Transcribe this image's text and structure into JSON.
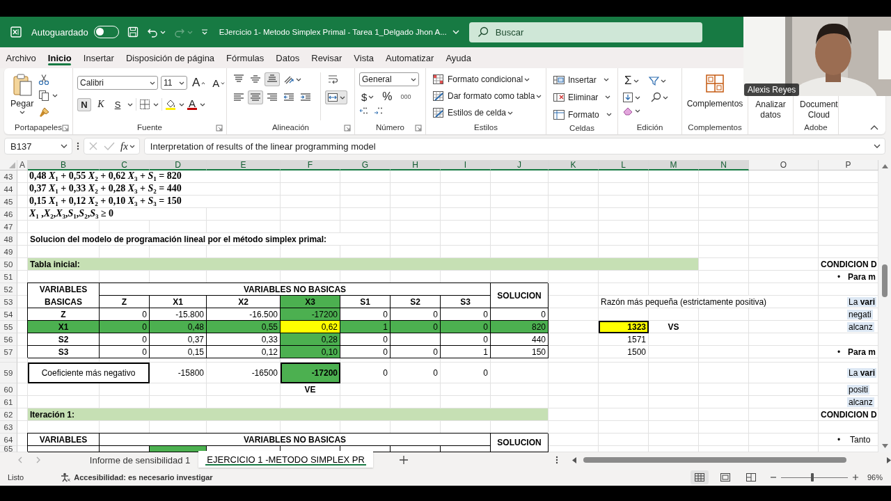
{
  "titlebar": {
    "autosave_label": "Autoguardado",
    "autosave": {
      "on": false
    },
    "title": "EJercicio 1- Metodo Simplex Primal - Tarea 1_Delgado Jhon A...",
    "search": {
      "placeholder": "Buscar"
    }
  },
  "menu": {
    "tabs": [
      {
        "label": "Archivo",
        "selected": false
      },
      {
        "label": "Inicio",
        "selected": true
      },
      {
        "label": "Insertar",
        "selected": false
      },
      {
        "label": "Disposición de página",
        "selected": false
      },
      {
        "label": "Fórmulas",
        "selected": false
      },
      {
        "label": "Datos",
        "selected": false
      },
      {
        "label": "Revisar",
        "selected": false
      },
      {
        "label": "Vista",
        "selected": false
      },
      {
        "label": "Automatizar",
        "selected": false
      },
      {
        "label": "Ayuda",
        "selected": false
      }
    ]
  },
  "ribbon": {
    "groups": [
      {
        "kind": "clipboard",
        "label": "Portapapeles",
        "paste": "Pegar"
      },
      {
        "kind": "font",
        "label": "Fuente",
        "font": "Calibri",
        "size": "11",
        "grow": "A",
        "shrink": "A",
        "styles": [
          {
            "kind": "bold",
            "label": "N",
            "pressed": true
          },
          {
            "kind": "italic",
            "label": "K",
            "pressed": false
          },
          {
            "kind": "underline",
            "label": "S",
            "pressed": false
          }
        ],
        "font_color": "A"
      },
      {
        "kind": "alignment",
        "label": "Alineación",
        "top_row": [
          {
            "kind": "top",
            "pressed": false
          },
          {
            "kind": "middle",
            "pressed": false
          },
          {
            "kind": "bottom",
            "pressed": true
          },
          {
            "kind": "orientation",
            "pressed": false
          },
          {
            "kind": "wrap",
            "pressed": false
          }
        ],
        "bottom_row": [
          {
            "kind": "left",
            "pressed": false
          },
          {
            "kind": "center",
            "pressed": true
          },
          {
            "kind": "right",
            "pressed": false
          },
          {
            "kind": "outdent",
            "pressed": false
          },
          {
            "kind": "indent",
            "pressed": false
          },
          {
            "kind": "merge",
            "pressed": true
          }
        ]
      },
      {
        "kind": "number",
        "label": "Número",
        "format": "General",
        "currency": "$",
        "percent": "%",
        "thousands": "000"
      },
      {
        "kind": "styles",
        "label": "Estilos",
        "items": [
          "Formato condicional",
          "Dar formato como tabla",
          "Estilos de celda"
        ]
      },
      {
        "kind": "cells",
        "label": "Celdas",
        "items": [
          "Insertar",
          "Eliminar",
          "Formato"
        ]
      },
      {
        "kind": "editing",
        "label": "Edición",
        "autosum": "Σ"
      },
      {
        "kind": "big",
        "label": "Complementos",
        "button": "Complementos"
      },
      {
        "kind": "covered",
        "button": "Analizar datos"
      },
      {
        "kind": "covered",
        "label": "Adobe",
        "button": "Document Cloud"
      }
    ]
  },
  "formula_bar": {
    "name_box": "B137",
    "fx": "fx",
    "content": "Interpretation of results of the linear programming model"
  },
  "sheet": {
    "columns": [
      {
        "label": "A",
        "selected": false
      },
      {
        "label": "B",
        "selected": true
      },
      {
        "label": "C",
        "selected": true
      },
      {
        "label": "D",
        "selected": true
      },
      {
        "label": "E",
        "selected": true
      },
      {
        "label": "F",
        "selected": true
      },
      {
        "label": "G",
        "selected": true
      },
      {
        "label": "H",
        "selected": true
      },
      {
        "label": "I",
        "selected": true
      },
      {
        "label": "J",
        "selected": true
      },
      {
        "label": "K",
        "selected": true
      },
      {
        "label": "L",
        "selected": true
      },
      {
        "label": "M",
        "selected": true
      },
      {
        "label": "N",
        "selected": true
      },
      {
        "label": "O",
        "selected": false
      },
      {
        "label": "P",
        "selected": false
      }
    ],
    "rows": [
      {
        "number": "43",
        "cells": [
          {
            "kind": "empty"
          },
          {
            "kind": "equation",
            "text": "0,48 *X*$_{1}$ + 0,55 *X*$_{2}$ + 0,62 *X*$_{3}$ + *S*$_{1}$ = 820"
          },
          {
            "kind": "merge"
          },
          {
            "kind": "merge"
          },
          {
            "kind": "merge"
          }
        ]
      },
      {
        "number": "44",
        "cells": [
          {
            "kind": "empty"
          },
          {
            "kind": "equation",
            "text": "0,37 *X*$_{1}$ + 0,33 *X*$_{2}$ + 0,28 *X*$_{3}$ + *S*$_{2}$ = 440"
          },
          {
            "kind": "merge"
          },
          {
            "kind": "merge"
          },
          {
            "kind": "merge"
          }
        ]
      },
      {
        "number": "45",
        "cells": [
          {
            "kind": "empty"
          },
          {
            "kind": "equation",
            "text": "0,15 *X*$_{1}$ + 0,12 *X*$_{2}$ + 0,10 *X*$_{3}$ + *S*$_{3}$ = 150"
          },
          {
            "kind": "merge"
          },
          {
            "kind": "merge"
          },
          {
            "kind": "merge"
          }
        ]
      },
      {
        "number": "46",
        "cells": [
          {
            "kind": "empty"
          },
          {
            "kind": "equation",
            "text": "*X*$_{1}$ ,*X*$_{2}$,*X*$_{3}$,*S*$_{1}$,*S*$_{2}$,*S*$_{3}$ ≥ 0"
          },
          {
            "kind": "merge"
          },
          {
            "kind": "merge"
          }
        ]
      },
      {
        "number": "47"
      },
      {
        "number": "48",
        "cells": [
          {
            "kind": "empty"
          },
          {
            "kind": "text",
            "bold": true,
            "text": "Solucion del modelo de programación lineal por el método simplex primal:"
          },
          {
            "kind": "merge"
          },
          {
            "kind": "merge"
          },
          {
            "kind": "merge"
          },
          {
            "kind": "merge"
          },
          {
            "kind": "merge"
          }
        ]
      },
      {
        "number": "49"
      },
      {
        "number": "50",
        "cells": [
          {
            "kind": "empty"
          },
          {
            "kind": "text",
            "bold": true,
            "color": "#c6e0b4",
            "text": "Tabla inicial:"
          },
          {
            "kind": "merge"
          },
          {
            "kind": "merge"
          },
          {
            "kind": "merge"
          },
          {
            "kind": "merge"
          },
          {
            "kind": "merge"
          },
          {
            "kind": "merge"
          },
          {
            "kind": "merge"
          },
          {
            "kind": "merge"
          },
          {
            "kind": "merge"
          },
          {
            "kind": "merge"
          },
          {
            "kind": "merge"
          },
          {
            "kind": "empty"
          },
          {
            "kind": "empty"
          },
          {
            "kind": "text",
            "bold": true,
            "text": "CONDICION D"
          }
        ]
      },
      {
        "number": "51",
        "cells": [
          {
            "kind": "empty"
          },
          {
            "kind": "empty"
          },
          {
            "kind": "empty"
          },
          {
            "kind": "empty"
          },
          {
            "kind": "empty"
          },
          {
            "kind": "empty"
          },
          {
            "kind": "empty"
          },
          {
            "kind": "empty"
          },
          {
            "kind": "empty"
          },
          {
            "kind": "empty"
          },
          {
            "kind": "empty"
          },
          {
            "kind": "empty"
          },
          {
            "kind": "empty"
          },
          {
            "kind": "empty"
          },
          {
            "kind": "empty"
          },
          {
            "kind": "bullet",
            "marker": "•",
            "bold": true,
            "text": "Para m"
          }
        ]
      },
      {
        "number": "52",
        "cells": [
          {
            "kind": "empty"
          },
          {
            "kind": "center",
            "bold": true,
            "bordered": true,
            "text": "VARIABLES BASICAS"
          },
          {
            "kind": "center",
            "bold": true,
            "bordered": true,
            "text": "VARIABLES NO BASICAS"
          },
          {
            "kind": "merge"
          },
          {
            "kind": "merge"
          },
          {
            "kind": "merge"
          },
          {
            "kind": "merge"
          },
          {
            "kind": "merge"
          },
          {
            "kind": "merge"
          },
          {
            "kind": "center",
            "bold": true,
            "bordered": true,
            "text": "SOLUCION"
          }
        ]
      },
      {
        "number": "53",
        "cells": [
          {
            "kind": "empty"
          },
          {
            "kind": "merge_up"
          },
          {
            "kind": "center",
            "bold": true,
            "bordered": true,
            "text": "Z"
          },
          {
            "kind": "center",
            "bold": true,
            "bordered": true,
            "text": "X1"
          },
          {
            "kind": "center",
            "bold": true,
            "bordered": true,
            "text": "X2"
          },
          {
            "kind": "center",
            "bold": true,
            "bordered": true,
            "color": "#4cb050",
            "text": "X3"
          },
          {
            "kind": "center",
            "bold": true,
            "bordered": true,
            "text": "S1"
          },
          {
            "kind": "center",
            "bold": true,
            "bordered": true,
            "text": "S2"
          },
          {
            "kind": "center",
            "bold": true,
            "bordered": true,
            "text": "S3"
          },
          {
            "kind": "merge_up"
          },
          {
            "kind": "empty"
          },
          {
            "kind": "text",
            "text": "Razón más pequeña (estrictamente positiva)"
          },
          {
            "kind": "merge"
          },
          {
            "kind": "merge"
          },
          {
            "kind": "merge"
          },
          {
            "kind": "note",
            "color": "#dde8f4",
            "text": "La **vari**"
          }
        ]
      },
      {
        "number": "54",
        "cells": [
          {
            "kind": "empty"
          },
          {
            "kind": "center",
            "bold": true,
            "bordered": true,
            "text": "Z"
          },
          {
            "kind": "number",
            "bordered": true,
            "text": "0"
          },
          {
            "kind": "number",
            "bordered": true,
            "text": "-15.800"
          },
          {
            "kind": "number",
            "bordered": true,
            "text": "-16.500"
          },
          {
            "kind": "number",
            "bordered": true,
            "color": "#4cb050",
            "text": "-17200"
          },
          {
            "kind": "number",
            "bordered": true,
            "text": "0"
          },
          {
            "kind": "number",
            "bordered": true,
            "text": "0"
          },
          {
            "kind": "number",
            "bordered": true,
            "text": "0"
          },
          {
            "kind": "number",
            "bordered": true,
            "text": "0"
          },
          {
            "kind": "empty"
          },
          {
            "kind": "empty"
          },
          {
            "kind": "empty"
          },
          {
            "kind": "empty"
          },
          {
            "kind": "empty"
          },
          {
            "kind": "note",
            "color": "#dde8f4",
            "text": "negati"
          }
        ]
      },
      {
        "number": "55",
        "cells": [
          {
            "kind": "empty"
          },
          {
            "kind": "center",
            "bold": true,
            "bordered": true,
            "color": "#4cb050",
            "text": "X1"
          },
          {
            "kind": "number",
            "bordered": true,
            "color": "#4cb050",
            "text": "0"
          },
          {
            "kind": "number",
            "bordered": true,
            "color": "#4cb050",
            "text": "0,48"
          },
          {
            "kind": "number",
            "bordered": true,
            "color": "#4cb050",
            "text": "0,55"
          },
          {
            "kind": "number",
            "bordered": true,
            "color": "#ffff00",
            "text": "0,62"
          },
          {
            "kind": "number",
            "bordered": true,
            "color": "#4cb050",
            "text": "1"
          },
          {
            "kind": "number",
            "bordered": true,
            "color": "#4cb050",
            "text": "0"
          },
          {
            "kind": "number",
            "bordered": true,
            "color": "#4cb050",
            "text": "0"
          },
          {
            "kind": "number",
            "bordered": true,
            "color": "#4cb050",
            "text": "820"
          },
          {
            "kind": "empty"
          },
          {
            "kind": "number",
            "bold": true,
            "heavy_border": true,
            "color": "#ffff00",
            "text": "1323"
          },
          {
            "kind": "center",
            "bold": true,
            "text": "VS"
          },
          {
            "kind": "empty"
          },
          {
            "kind": "empty"
          },
          {
            "kind": "note",
            "color": "#dde8f4",
            "text": "alcanz"
          }
        ]
      },
      {
        "number": "56",
        "cells": [
          {
            "kind": "empty"
          },
          {
            "kind": "center",
            "bold": true,
            "bordered": true,
            "text": "S2"
          },
          {
            "kind": "number",
            "bordered": true,
            "text": "0"
          },
          {
            "kind": "number",
            "bordered": true,
            "text": "0,37"
          },
          {
            "kind": "number",
            "bordered": true,
            "text": "0,33"
          },
          {
            "kind": "number",
            "bordered": true,
            "color": "#4cb050",
            "text": "0,28"
          },
          {
            "kind": "number",
            "bordered": true,
            "text": "0"
          },
          {
            "kind": "empty"
          },
          {
            "kind": "number",
            "bordered": true,
            "text": "0"
          },
          {
            "kind": "number",
            "bordered": true,
            "text": "440"
          },
          {
            "kind": "empty"
          },
          {
            "kind": "number",
            "text": "1571"
          }
        ]
      },
      {
        "number": "57",
        "cells": [
          {
            "kind": "empty"
          },
          {
            "kind": "center",
            "bold": true,
            "bordered": true,
            "text": "S3"
          },
          {
            "kind": "number",
            "bordered": true,
            "text": "0"
          },
          {
            "kind": "number",
            "bordered": true,
            "text": "0,15"
          },
          {
            "kind": "number",
            "bordered": true,
            "text": "0,12"
          },
          {
            "kind": "number",
            "bordered": true,
            "color": "#4cb050",
            "text": "0,10"
          },
          {
            "kind": "number",
            "bordered": true,
            "text": "0"
          },
          {
            "kind": "number",
            "bordered": true,
            "text": "0"
          },
          {
            "kind": "number",
            "bordered": true,
            "text": "1"
          },
          {
            "kind": "number",
            "bordered": true,
            "text": "150"
          },
          {
            "kind": "empty"
          },
          {
            "kind": "number",
            "text": "1500"
          },
          {
            "kind": "empty"
          },
          {
            "kind": "empty"
          },
          {
            "kind": "empty"
          },
          {
            "kind": "bullet",
            "marker": "•",
            "bold": true,
            "text": "Para m"
          }
        ]
      },
      {},
      {
        "number": "59",
        "cells": [
          {
            "kind": "empty"
          },
          {
            "kind": "center",
            "heavy_border": true,
            "text": "Coeficiente más negativo"
          },
          {
            "kind": "merge"
          },
          {
            "kind": "number",
            "text": "-15800"
          },
          {
            "kind": "number",
            "text": "-16500"
          },
          {
            "kind": "number",
            "bold": true,
            "heavy_border": true,
            "color": "#4cb050",
            "text": "-17200"
          },
          {
            "kind": "number",
            "text": "0"
          },
          {
            "kind": "number",
            "text": "0"
          },
          {
            "kind": "number",
            "text": "0"
          },
          {
            "kind": "empty"
          },
          {
            "kind": "empty"
          },
          {
            "kind": "empty"
          },
          {
            "kind": "empty"
          },
          {
            "kind": "empty"
          },
          {
            "kind": "empty"
          },
          {
            "kind": "note",
            "color": "#dde8f4",
            "text": "La **vari**"
          }
        ]
      },
      {
        "number": "60",
        "cells": [
          {
            "kind": "empty"
          },
          {
            "kind": "empty"
          },
          {
            "kind": "empty"
          },
          {
            "kind": "empty"
          },
          {
            "kind": "empty"
          },
          {
            "kind": "center",
            "bold": true,
            "text": "VE"
          },
          {
            "kind": "empty"
          },
          {
            "kind": "empty"
          },
          {
            "kind": "empty"
          },
          {
            "kind": "empty"
          },
          {
            "kind": "empty"
          },
          {
            "kind": "empty"
          },
          {
            "kind": "empty"
          },
          {
            "kind": "empty"
          },
          {
            "kind": "empty"
          },
          {
            "kind": "note",
            "color": "#dde8f4",
            "text": "positi"
          }
        ]
      },
      {
        "number": "61",
        "cells": [
          {
            "kind": "empty"
          },
          {
            "kind": "empty"
          },
          {
            "kind": "empty"
          },
          {
            "kind": "empty"
          },
          {
            "kind": "empty"
          },
          {
            "kind": "empty"
          },
          {
            "kind": "empty"
          },
          {
            "kind": "empty"
          },
          {
            "kind": "empty"
          },
          {
            "kind": "empty"
          },
          {
            "kind": "empty"
          },
          {
            "kind": "empty"
          },
          {
            "kind": "empty"
          },
          {
            "kind": "empty"
          },
          {
            "kind": "empty"
          },
          {
            "kind": "note",
            "color": "#dde8f4",
            "text": "alcanz"
          }
        ]
      },
      {
        "number": "62",
        "cells": [
          {
            "kind": "empty"
          },
          {
            "kind": "text",
            "bold": true,
            "color": "#c6e0b4",
            "text": "Iteración 1:"
          },
          {
            "kind": "merge"
          },
          {
            "kind": "merge"
          },
          {
            "kind": "merge"
          },
          {
            "kind": "merge"
          },
          {
            "kind": "merge"
          },
          {
            "kind": "merge"
          },
          {
            "kind": "merge"
          },
          {
            "kind": "merge"
          },
          {
            "kind": "empty"
          },
          {
            "kind": "empty"
          },
          {
            "kind": "empty"
          },
          {
            "kind": "empty"
          },
          {
            "kind": "empty"
          },
          {
            "kind": "text",
            "bold": true,
            "text": "CONDICION D"
          }
        ]
      },
      {
        "number": "63"
      },
      {
        "number": "64",
        "cells": [
          {
            "kind": "empty"
          },
          {
            "kind": "center",
            "bold": true,
            "bordered": true,
            "text": "VARIABLES"
          },
          {
            "kind": "center",
            "bold": true,
            "bordered": true,
            "text": "VARIABLES NO BASICAS"
          },
          {
            "kind": "merge"
          },
          {
            "kind": "merge"
          },
          {
            "kind": "merge"
          },
          {
            "kind": "merge"
          },
          {
            "kind": "merge"
          },
          {
            "kind": "merge"
          },
          {
            "kind": "center",
            "bold": true,
            "bordered": true,
            "text": "SOLUCION"
          },
          {
            "kind": "empty"
          },
          {
            "kind": "empty"
          },
          {
            "kind": "empty"
          },
          {
            "kind": "empty"
          },
          {
            "kind": "empty"
          },
          {
            "kind": "bullet",
            "marker": "•",
            "text": "Tanto"
          }
        ]
      },
      {
        "number": "65",
        "cells": [
          {
            "kind": "empty"
          },
          {
            "kind": "empty",
            "bordered": true
          },
          {
            "kind": "empty",
            "bordered": true
          },
          {
            "kind": "empty",
            "bordered": true,
            "color": "#4cb050"
          },
          {
            "kind": "empty",
            "bordered": true
          },
          {
            "kind": "empty",
            "bordered": true
          },
          {
            "kind": "empty",
            "bordered": true
          },
          {
            "kind": "empty",
            "bordered": true
          },
          {
            "kind": "empty",
            "bordered": true
          },
          {
            "kind": "merge_up"
          }
        ]
      }
    ]
  },
  "sheet_tabs": {
    "tabs": [
      {
        "label": "Informe de sensibilidad 1",
        "selected": false
      },
      {
        "label": "EJERCICIO 1 -METODO SIMPLEX PR",
        "selected": true
      }
    ]
  },
  "status_bar": {
    "mode": "Listo",
    "accessibility": "Accesibilidad: es necesario investigar",
    "views": [
      {
        "kind": "normal",
        "selected": true
      },
      {
        "kind": "page_layout",
        "selected": false
      },
      {
        "kind": "page_break",
        "selected": false
      }
    ],
    "zoom": {
      "level": 0.47,
      "reading": "96%"
    }
  },
  "webcam": {
    "kind": "picture",
    "name": "Alexis Reyes"
  }
}
